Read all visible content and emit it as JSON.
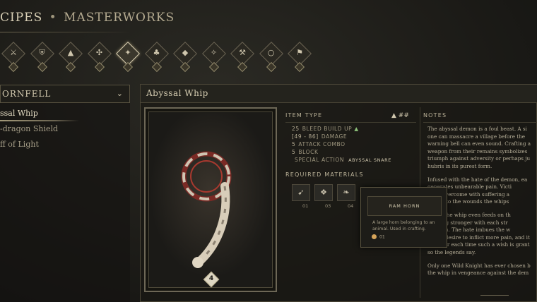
{
  "header": {
    "title_left": "CIPES",
    "separator": "•",
    "title_right": "MASTERWORKS"
  },
  "categories": [
    {
      "icon": "sword-icon",
      "glyph": "⚔",
      "badge": "+"
    },
    {
      "icon": "shield-icon",
      "glyph": "⛨",
      "badge": "+"
    },
    {
      "icon": "helm-icon",
      "glyph": "▲",
      "badge": "+"
    },
    {
      "icon": "gauntlet-icon",
      "glyph": "✣",
      "badge": "+"
    },
    {
      "icon": "staff-icon",
      "glyph": "✦",
      "badge": "+",
      "active": true
    },
    {
      "icon": "axe-icon",
      "glyph": "♣",
      "badge": "+"
    },
    {
      "icon": "dagger-icon",
      "glyph": "◆",
      "badge": "+"
    },
    {
      "icon": "amulet-icon",
      "glyph": "✧",
      "badge": "+"
    },
    {
      "icon": "hammer-icon",
      "glyph": "⚒",
      "badge": "+"
    },
    {
      "icon": "ring-icon",
      "glyph": "○",
      "badge": "+"
    },
    {
      "icon": "banner-icon",
      "glyph": "⚑",
      "badge": "+"
    }
  ],
  "left_panel": {
    "region": "ORNFELL",
    "recipes": [
      "ssal Whip",
      "-dragon Shield",
      "ff of Light"
    ]
  },
  "main": {
    "title": "Abyssal Whip",
    "card_count": "4",
    "item_type_label": "ITEM TYPE",
    "type_marker": "▲  ##",
    "stats": [
      {
        "value": "25",
        "label": "BLEED BUILD UP",
        "up": "▲"
      },
      {
        "value": "[49 - 86]",
        "label": "DAMAGE"
      },
      {
        "value": "5",
        "label": "ATTACK COMBO"
      },
      {
        "value": "5",
        "label": "BLOCK"
      },
      {
        "value": "",
        "label": "SPECIAL ACTION",
        "extra": "ABYSSAL SNARE"
      }
    ],
    "materials_label": "REQUIRED MATERIALS",
    "materials": [
      {
        "icon": "ram-horn-icon",
        "glyph": "➹",
        "count": "01"
      },
      {
        "icon": "ore-icon",
        "glyph": "❖",
        "count": "03"
      },
      {
        "icon": "claw-icon",
        "glyph": "❧",
        "count": "04"
      }
    ],
    "notes_label": "NOTES",
    "notes": [
      "The abyssal demon is a foul beast. A si\none can massacre a village before the\nwarning bell can even sound. Crafting a\nweapon from their remains symbolizes\ntriumph against adversity or perhaps ju\nhubris in its purest form.",
      "Infused with the hate of the demon, ea\ngenerates unbearable pain. Victi\nelves overcome with suffering a\neeps into the wounds the whips",
      "d that the whip even feeds on th\ngrowing stronger with each str\nfe taken. The hate imbues the w\nwith a desire to inflict more pain, and it\nstronger each time such a wish is grant\nso the legends say.",
      "Only one Wild Knight has ever chosen b\nthe whip in vengeance against the dem"
    ]
  },
  "tooltip": {
    "title": "RAM HORN",
    "description": "A large horn belonging to an animal. Used in crafting.",
    "count": "01"
  },
  "colors": {
    "accent": "#d8ceb1",
    "bleed_up": "#8ec27a"
  }
}
